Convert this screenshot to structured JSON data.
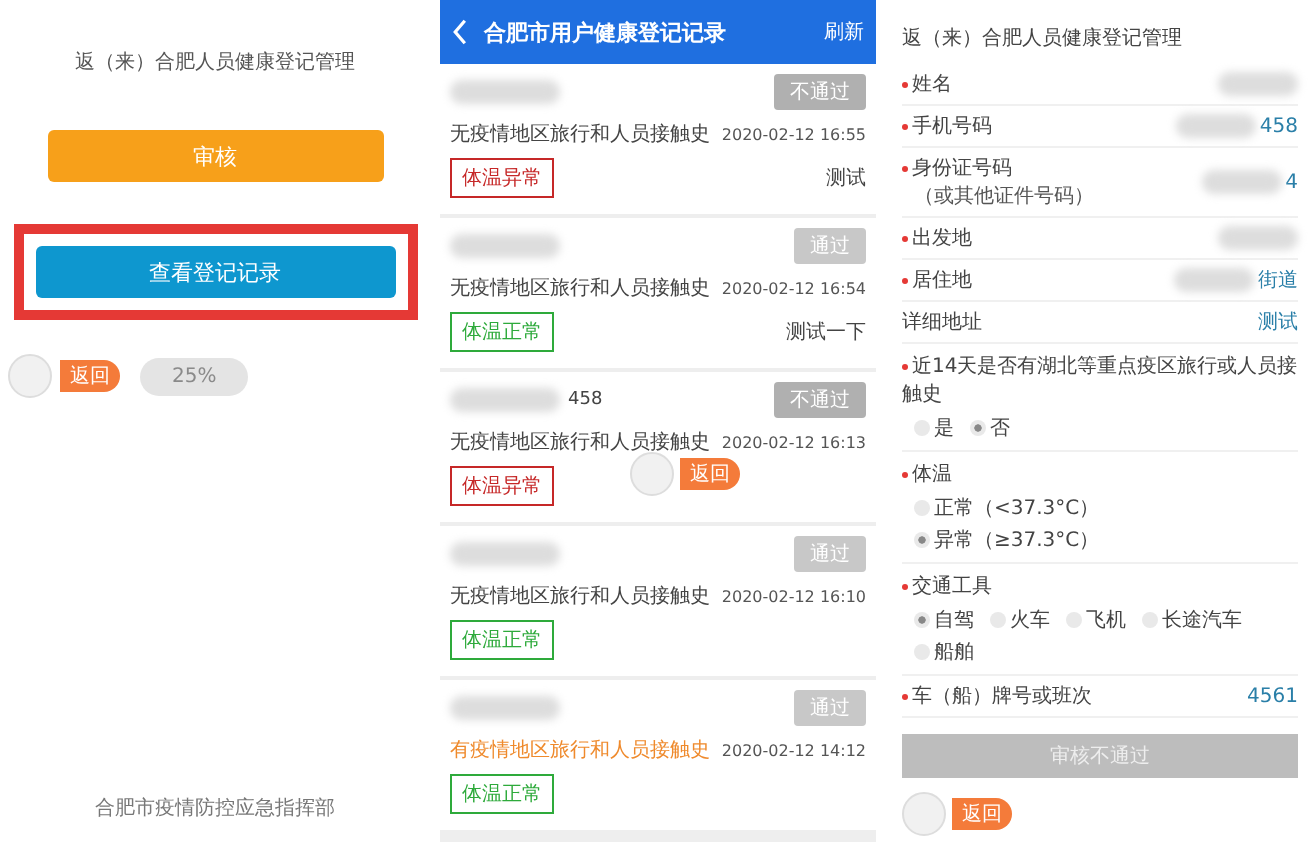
{
  "home": {
    "title": "返（来）合肥人员健康登记管理",
    "buttons": [
      {
        "label": "审核",
        "kind": "review",
        "highlighted": false
      },
      {
        "label": "查看登记记录",
        "kind": "records",
        "highlighted": true
      }
    ],
    "assistant": {
      "badge": "返回",
      "progress": "25%"
    },
    "footer": "合肥市疫情防控应急指挥部"
  },
  "records": {
    "title": "合肥市用户健康登记记录",
    "action": "刷新",
    "assistant_badge": "返回",
    "cards": [
      {
        "redacted": true,
        "status": "不通过",
        "passed": false,
        "exposure": "无疫情地区旅行和人员接触史",
        "exposure_risk": false,
        "time": "2020-02-12 16:55",
        "temperature": "体温异常",
        "temp_abnormal": true,
        "remark": "测试"
      },
      {
        "redacted": true,
        "status": "通过",
        "passed": true,
        "exposure": "无疫情地区旅行和人员接触史",
        "exposure_risk": false,
        "time": "2020-02-12 16:54",
        "temperature": "体温正常",
        "temp_abnormal": false,
        "remark": "测试一下"
      },
      {
        "redacted": true,
        "name": "458",
        "status": "不通过",
        "passed": false,
        "exposure": "无疫情地区旅行和人员接触史",
        "exposure_risk": false,
        "time": "2020-02-12 16:13",
        "temperature": "体温异常",
        "temp_abnormal": true
      },
      {
        "redacted": true,
        "status": "通过",
        "passed": true,
        "exposure": "无疫情地区旅行和人员接触史",
        "exposure_risk": false,
        "time": "2020-02-12 16:10",
        "temperature": "体温正常",
        "temp_abnormal": false
      },
      {
        "redacted": true,
        "status": "通过",
        "passed": true,
        "exposure": "有疫情地区旅行和人员接触史",
        "exposure_risk": true,
        "time": "2020-02-12 14:12",
        "temperature": "体温正常",
        "temp_abnormal": false
      }
    ]
  },
  "form": {
    "title": "返（来）合肥人员健康登记管理",
    "assistant_badge": "返回",
    "fields": [
      {
        "label": "姓名",
        "required": true,
        "redacted": true
      },
      {
        "label": "手机号码",
        "required": true,
        "redacted": true,
        "value": "458"
      },
      {
        "label": "身份证号码",
        "note": "（或其他证件号码）",
        "required": true,
        "redacted": true,
        "value": "4"
      },
      {
        "label": "出发地",
        "required": true,
        "redacted": true
      },
      {
        "label": "居住地",
        "required": true,
        "redacted": true,
        "value": "街道"
      },
      {
        "label": "详细地址",
        "value": "测试"
      }
    ],
    "questions": [
      {
        "label": "近14天是否有湖北等重点疫区旅行或人员接触史",
        "required": true,
        "options": [
          {
            "label": "是",
            "selected": false
          },
          {
            "label": "否",
            "selected": true
          }
        ]
      },
      {
        "label": "体温",
        "required": true,
        "options": [
          {
            "label": "正常（<37.3°C）",
            "selected": false
          },
          {
            "label": "异常（≥37.3°C）",
            "selected": true
          }
        ]
      },
      {
        "label": "交通工具",
        "required": true,
        "options": [
          {
            "label": "自驾",
            "selected": true
          },
          {
            "label": "火车",
            "selected": false
          },
          {
            "label": "飞机",
            "selected": false
          },
          {
            "label": "长途汽车",
            "selected": false
          },
          {
            "label": "船舶",
            "selected": false
          }
        ]
      }
    ],
    "plate": {
      "label": "车（船）牌号或班次",
      "required": true,
      "value": "4561"
    },
    "submit": {
      "label": "审核不通过",
      "disabled": true
    }
  }
}
